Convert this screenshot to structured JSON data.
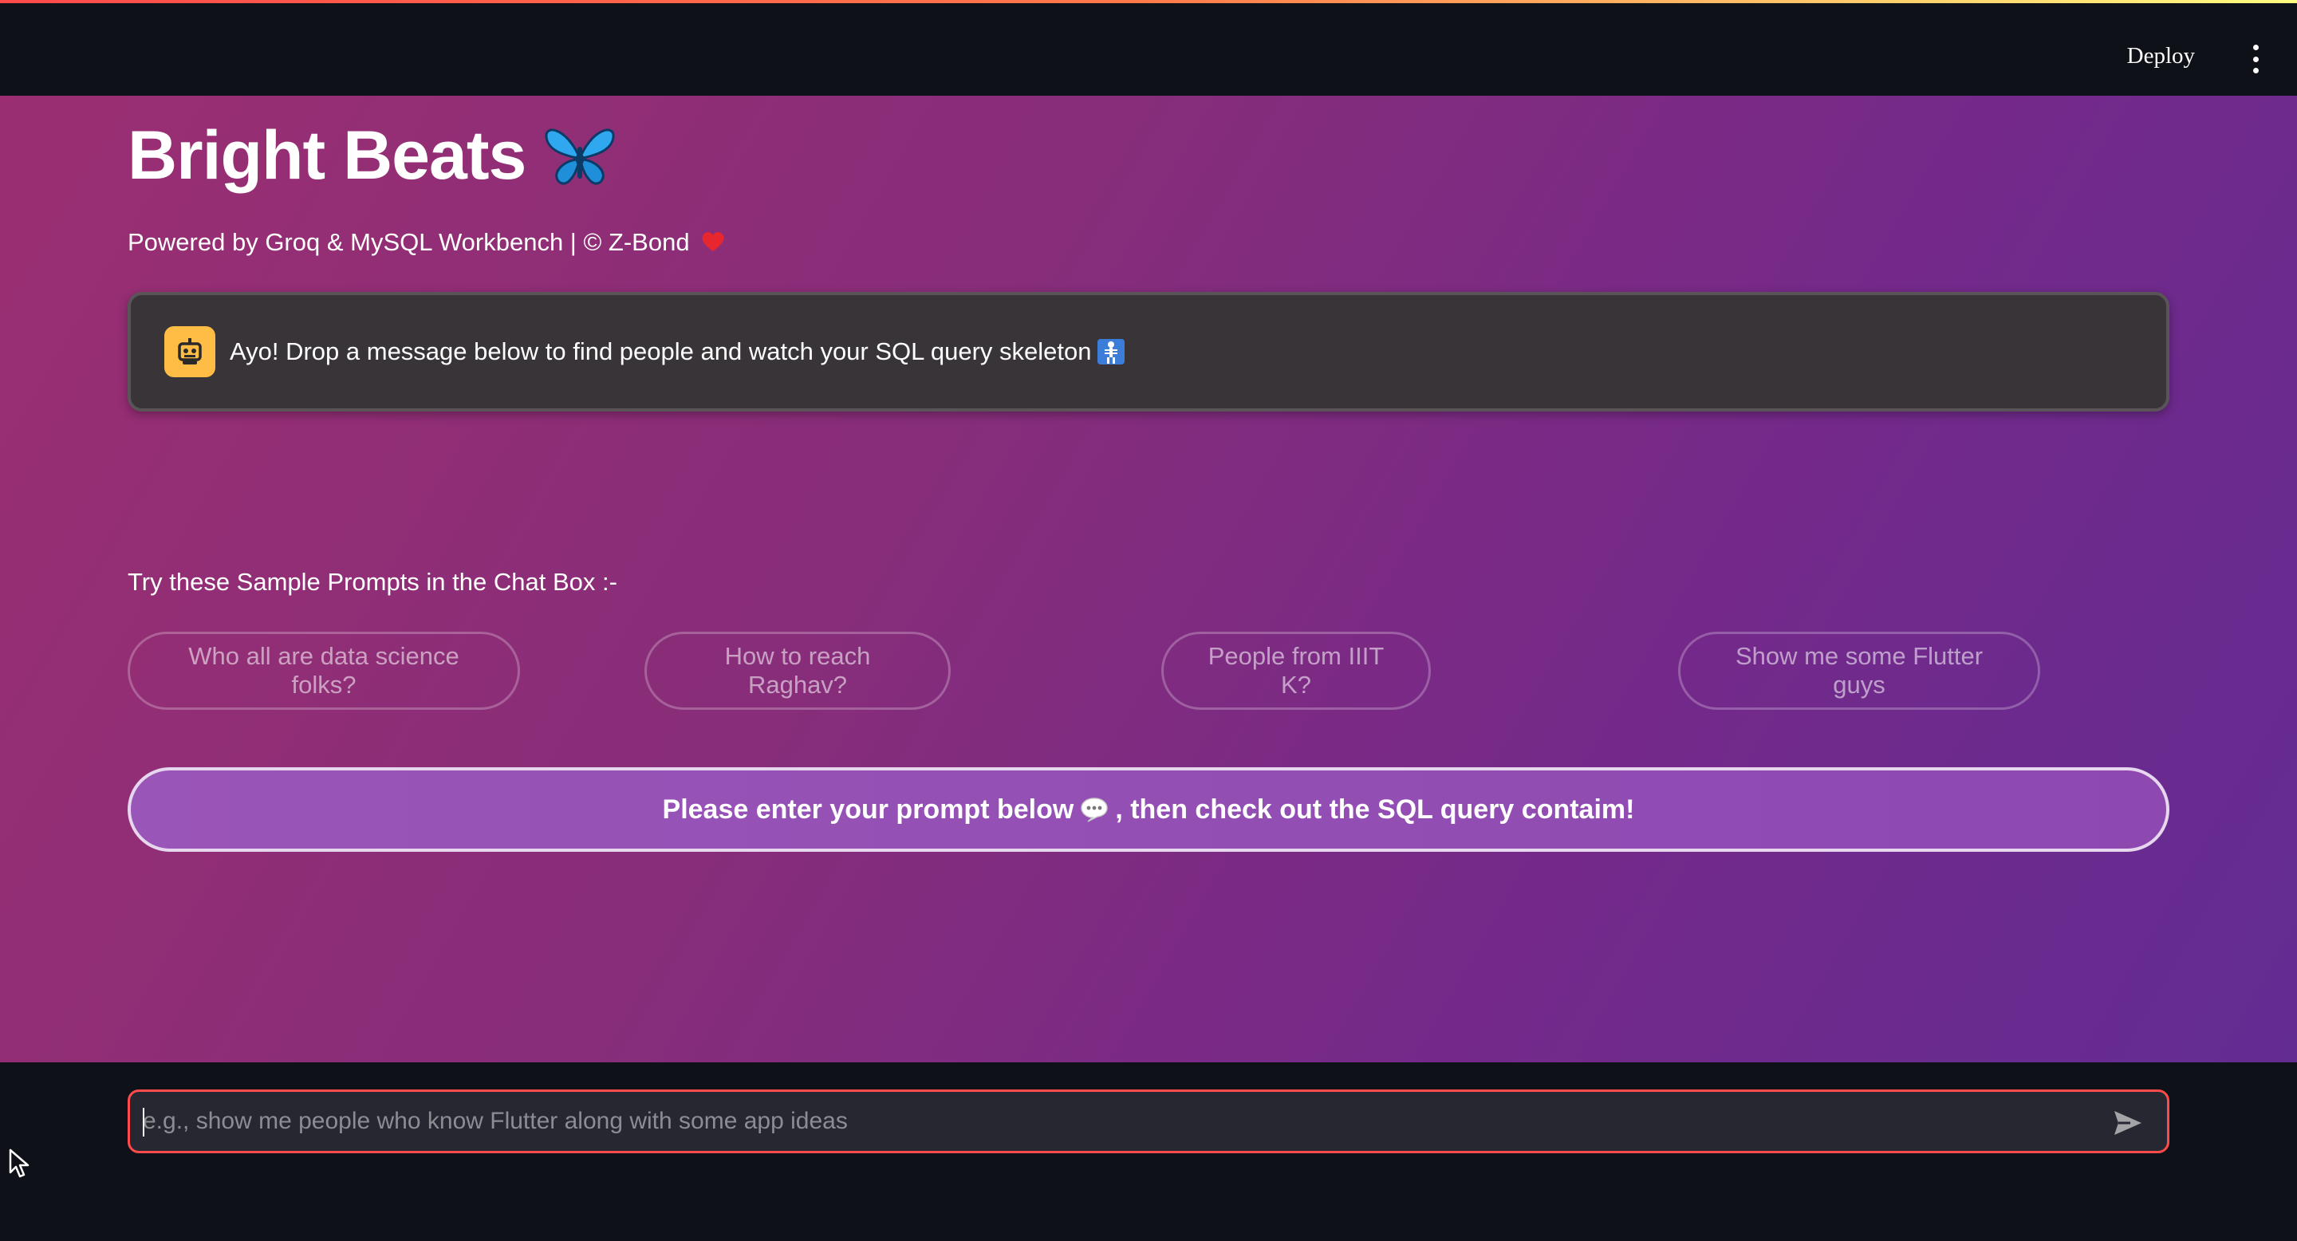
{
  "header": {
    "deploy_label": "Deploy",
    "menu_icon": "vertical-ellipsis-icon"
  },
  "main": {
    "title": "Bright Beats",
    "title_icon": "butterfly-icon",
    "subtitle": "Powered by Groq & MySQL Workbench | © Z-Bond",
    "subtitle_icon": "heart-icon",
    "assistant_message": {
      "avatar_icon": "robot-icon",
      "text": "Ayo! Drop a message below to find people and watch your SQL query skeleton",
      "trailing_icon": "x-ray-icon"
    },
    "samples_label": "Try these Sample Prompts in the Chat Box :-",
    "sample_prompts": [
      "Who all are data science folks?",
      "How to reach Raghav?",
      "People from IIIT K?",
      "Show me some Flutter guys"
    ],
    "prompt_banner": {
      "text_before": "Please enter your prompt below",
      "icon": "speech-bubble-icon",
      "text_after": ", then check out the SQL query contaim!"
    }
  },
  "chat_input": {
    "placeholder": "e.g., show me people who know Flutter along with some app ideas",
    "value": "",
    "send_icon": "send-icon"
  },
  "colors": {
    "accent": "#ff4b4b",
    "header_bg": "#0e1117",
    "gradient_start": "#9b2e72",
    "gradient_end": "#632c92",
    "avatar_bg": "#ffbd45"
  }
}
